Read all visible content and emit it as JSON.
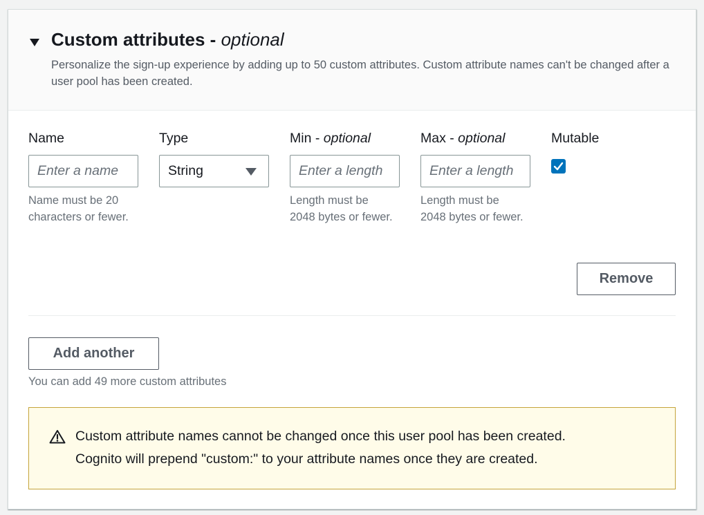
{
  "header": {
    "title": "Custom attributes -",
    "title_optional": "optional",
    "description": "Personalize the sign-up experience by adding up to 50 custom attributes. Custom attribute names can't be changed after a user pool has been created."
  },
  "attribute_row": {
    "name": {
      "label": "Name",
      "placeholder": "Enter a name",
      "value": "",
      "hint": "Name must be 20 characters or fewer."
    },
    "type": {
      "label": "Type",
      "selected": "String"
    },
    "min": {
      "label": "Min -",
      "label_optional": "optional",
      "placeholder": "Enter a length",
      "value": "",
      "hint": "Length must be 2048 bytes or fewer."
    },
    "max": {
      "label": "Max -",
      "label_optional": "optional",
      "placeholder": "Enter a length",
      "value": "",
      "hint": "Length must be 2048 bytes or fewer."
    },
    "mutable": {
      "label": "Mutable",
      "checked": true
    },
    "remove_label": "Remove"
  },
  "actions": {
    "add_label": "Add another",
    "add_hint": "You can add 49 more custom attributes"
  },
  "alert": {
    "icon": "warning-icon",
    "line1": "Custom attribute names cannot be changed once this user pool has been created.",
    "line2": "Cognito will prepend \"custom:\" to your attribute names once they are created."
  },
  "colors": {
    "accent": "#0073bb",
    "alert_background": "#fffce9",
    "alert_border": "#c5a43a"
  }
}
